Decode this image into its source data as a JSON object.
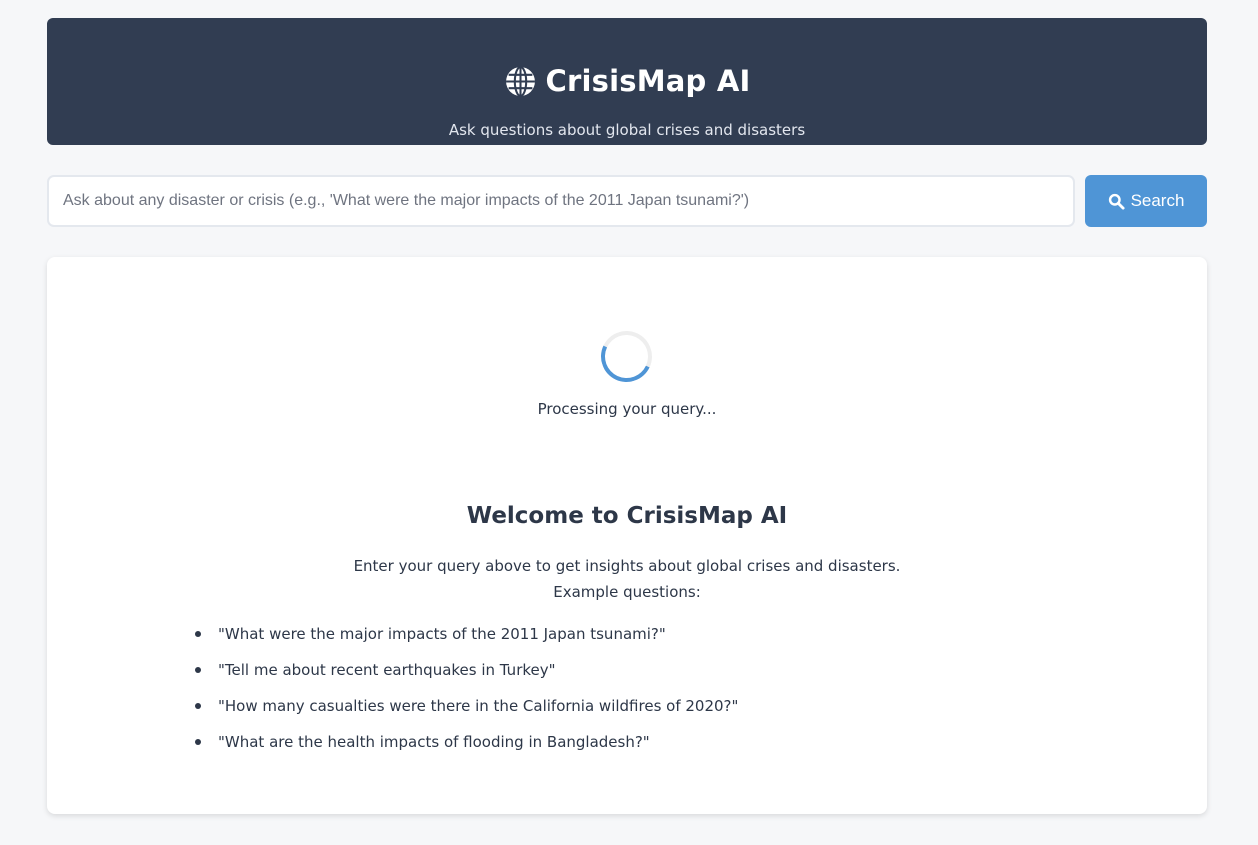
{
  "header": {
    "icon": "globe-icon",
    "title": "CrisisMap AI",
    "subtitle": "Ask questions about global crises and disasters"
  },
  "search": {
    "placeholder": "Ask about any disaster or crisis (e.g., 'What were the major impacts of the 2011 Japan tsunami?')",
    "value": "",
    "button_icon": "search-icon",
    "button_label": "Search"
  },
  "loading": {
    "text": "Processing your query..."
  },
  "welcome": {
    "title": "Welcome to CrisisMap AI",
    "intro": "Enter your query above to get insights about global crises and disasters.",
    "examples_label": "Example questions:",
    "examples": [
      "\"What were the major impacts of the 2011 Japan tsunami?\"",
      "\"Tell me about recent earthquakes in Turkey\"",
      "\"How many casualties were there in the California wildfires of 2020?\"",
      "\"What are the health impacts of flooding in Bangladesh?\""
    ]
  },
  "colors": {
    "header_bg": "#313d52",
    "accent": "#4f95d6",
    "page_bg": "#f6f7f9",
    "text": "#2d3748"
  }
}
